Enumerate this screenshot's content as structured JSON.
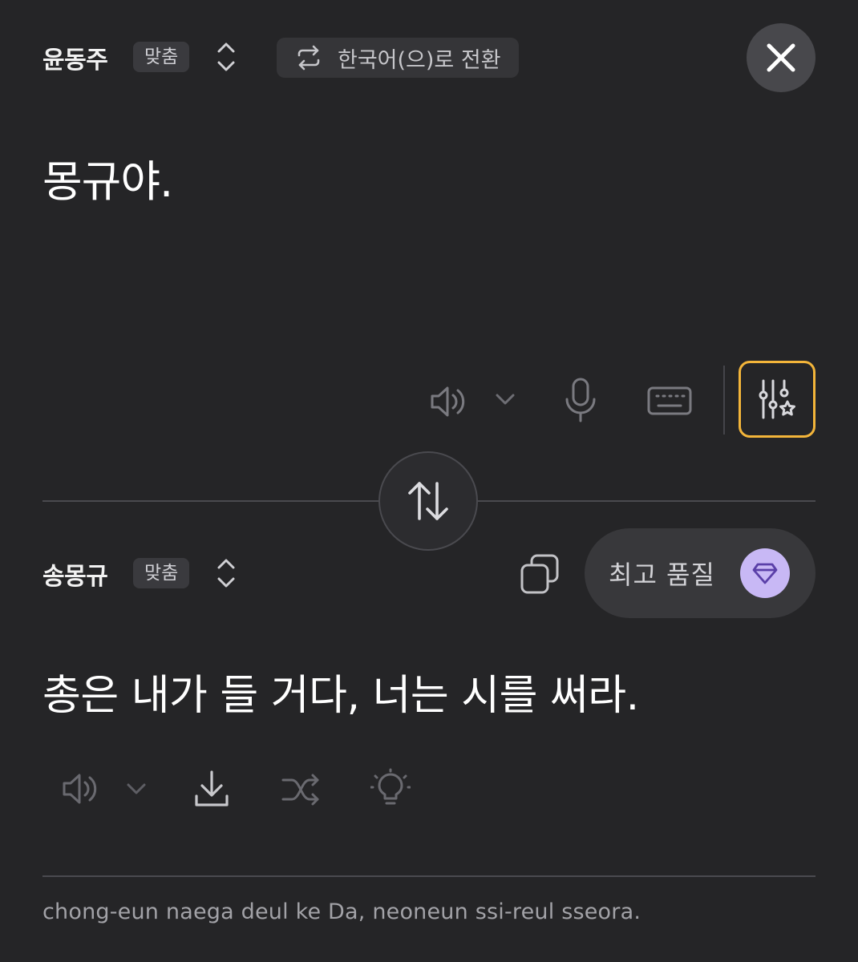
{
  "source": {
    "language": "윤동주",
    "badge": "맞춤",
    "switch_label": "한국어(으)로 전환",
    "text": "몽규야."
  },
  "target": {
    "language": "송몽규",
    "badge": "맞춤",
    "quality_label": "최고 품질",
    "text": "총은 내가 들 거다, 너는 시를 써라.",
    "romanization": "chong-eun naega deul ke Da, neoneun ssi-reul sseora."
  },
  "colors": {
    "background": "#252527",
    "highlight": "#f3b53a",
    "gem": "#c8b8f5"
  },
  "icons": {
    "close": "close-icon",
    "switch": "repeat-icon",
    "speaker": "speaker-icon",
    "mic": "microphone-icon",
    "keyboard": "keyboard-icon",
    "settings": "sliders-star-icon",
    "swap": "swap-vertical-icon",
    "copy": "copy-icon",
    "gem": "diamond-icon",
    "download": "download-icon",
    "shuffle": "shuffle-icon",
    "bulb": "lightbulb-icon"
  }
}
